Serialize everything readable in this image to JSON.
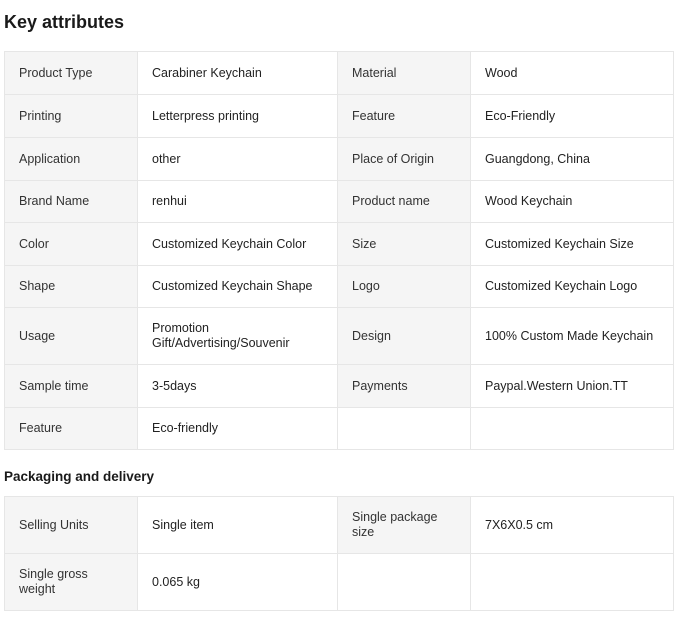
{
  "key_attributes": {
    "title": "Key attributes",
    "rows": [
      [
        {
          "k": "Product Type",
          "v": "Carabiner Keychain"
        },
        {
          "k": "Material",
          "v": "Wood"
        }
      ],
      [
        {
          "k": "Printing",
          "v": "Letterpress printing"
        },
        {
          "k": "Feature",
          "v": "Eco-Friendly"
        }
      ],
      [
        {
          "k": "Application",
          "v": "other"
        },
        {
          "k": "Place of Origin",
          "v": "Guangdong, China"
        }
      ],
      [
        {
          "k": "Brand Name",
          "v": "renhui"
        },
        {
          "k": "Product name",
          "v": "Wood Keychain"
        }
      ],
      [
        {
          "k": "Color",
          "v": "Customized Keychain Color"
        },
        {
          "k": "Size",
          "v": "Customized Keychain Size"
        }
      ],
      [
        {
          "k": "Shape",
          "v": "Customized Keychain Shape"
        },
        {
          "k": "Logo",
          "v": "Customized Keychain Logo"
        }
      ],
      [
        {
          "k": "Usage",
          "v": "Promotion Gift/Advertising/Souvenir"
        },
        {
          "k": "Design",
          "v": "100% Custom Made Keychain"
        }
      ],
      [
        {
          "k": "Sample time",
          "v": "3-5days"
        },
        {
          "k": "Payments",
          "v": "Paypal.Western Union.TT"
        }
      ],
      [
        {
          "k": "Feature",
          "v": "Eco-friendly"
        }
      ]
    ]
  },
  "packaging": {
    "title": "Packaging and delivery",
    "rows": [
      [
        {
          "k": "Selling Units",
          "v": "Single item"
        },
        {
          "k": "Single package size",
          "v": "7X6X0.5 cm"
        }
      ],
      [
        {
          "k": "Single gross weight",
          "v": "0.065 kg"
        }
      ]
    ]
  }
}
